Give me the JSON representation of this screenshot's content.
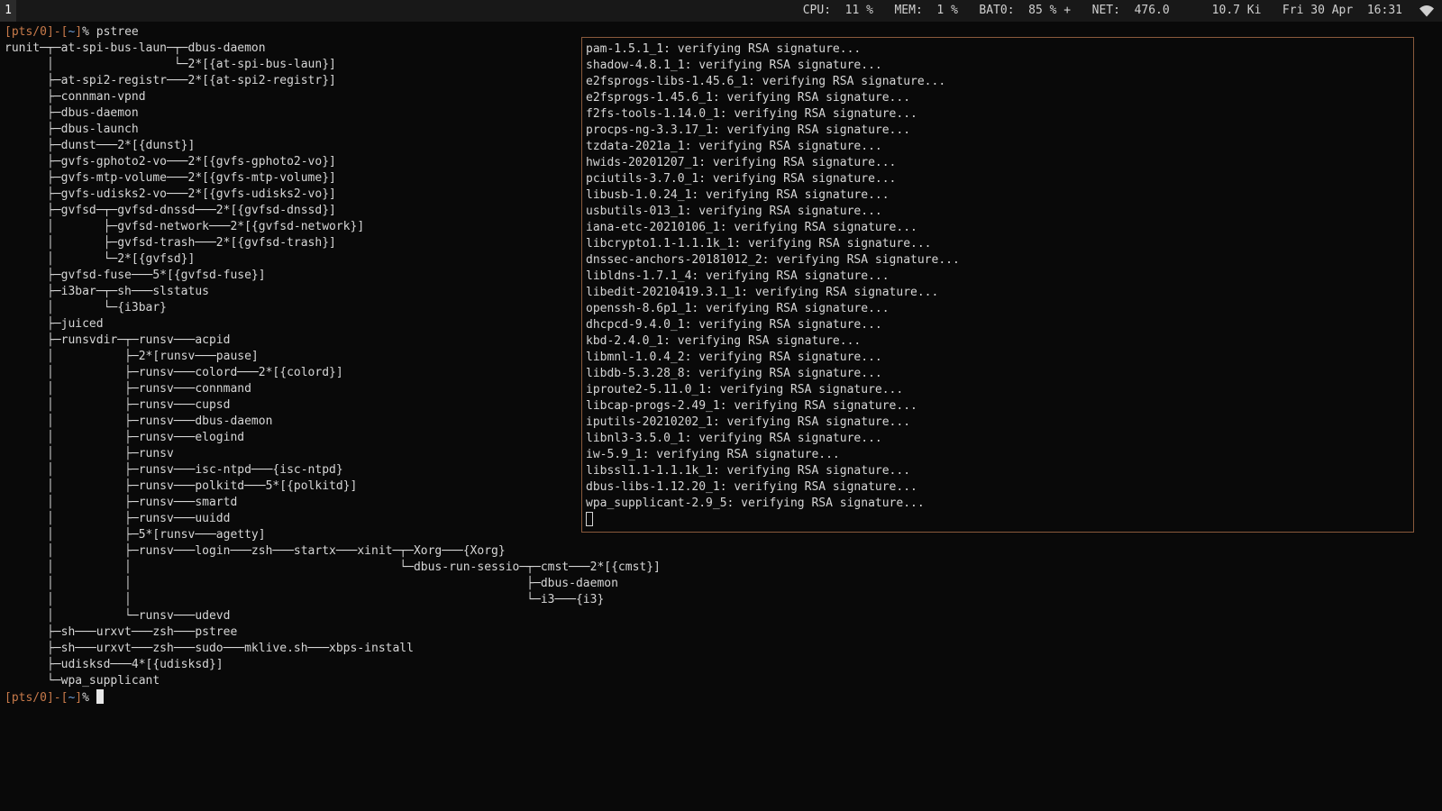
{
  "topbar": {
    "workspace": "1",
    "status": "CPU:  11 %   MEM:  1 %   BAT0:  85 % +   NET:  476.0      10.7 Ki   Fri 30 Apr  16:31",
    "wifi_icon": "wifi-icon"
  },
  "pstree_terminal": {
    "prompt": {
      "open": "[",
      "tty": "pts/0",
      "close": "]",
      "dash": "-",
      "path_open": "[",
      "path": "~",
      "path_close": "]",
      "symbol": "% "
    },
    "command": "pstree",
    "tree_lines": [
      "runit─┬─at-spi-bus-laun─┬─dbus-daemon",
      "      │                 └─2*[{at-spi-bus-laun}]",
      "      ├─at-spi2-registr───2*[{at-spi2-registr}]",
      "      ├─connman-vpnd",
      "      ├─dbus-daemon",
      "      ├─dbus-launch",
      "      ├─dunst───2*[{dunst}]",
      "      ├─gvfs-gphoto2-vo───2*[{gvfs-gphoto2-vo}]",
      "      ├─gvfs-mtp-volume───2*[{gvfs-mtp-volume}]",
      "      ├─gvfs-udisks2-vo───2*[{gvfs-udisks2-vo}]",
      "      ├─gvfsd─┬─gvfsd-dnssd───2*[{gvfsd-dnssd}]",
      "      │       ├─gvfsd-network───2*[{gvfsd-network}]",
      "      │       ├─gvfsd-trash───2*[{gvfsd-trash}]",
      "      │       └─2*[{gvfsd}]",
      "      ├─gvfsd-fuse───5*[{gvfsd-fuse}]",
      "      ├─i3bar─┬─sh───slstatus",
      "      │       └─{i3bar}",
      "      ├─juiced",
      "      ├─runsvdir─┬─runsv───acpid",
      "      │          ├─2*[runsv───pause]",
      "      │          ├─runsv───colord───2*[{colord}]",
      "      │          ├─runsv───connmand",
      "      │          ├─runsv───cupsd",
      "      │          ├─runsv───dbus-daemon",
      "      │          ├─runsv───elogind",
      "      │          ├─runsv",
      "      │          ├─runsv───isc-ntpd───{isc-ntpd}",
      "      │          ├─runsv───polkitd───5*[{polkitd}]",
      "      │          ├─runsv───smartd",
      "      │          ├─runsv───uuidd",
      "      │          ├─5*[runsv───agetty]",
      "      │          ├─runsv───login───zsh───startx───xinit─┬─Xorg───{Xorg}",
      "      │          │                                      └─dbus-run-sessio─┬─cmst───2*[{cmst}]",
      "      │          │                                                        ├─dbus-daemon",
      "      │          │                                                        └─i3───{i3}",
      "      │          └─runsv───udevd",
      "      ├─sh───urxvt───zsh───pstree",
      "      ├─sh───urxvt───zsh───sudo───mklive.sh───xbps-install",
      "      ├─udisksd───4*[{udisksd}]",
      "      └─wpa_supplicant"
    ]
  },
  "xbps_terminal": {
    "lines": [
      "pam-1.5.1_1: verifying RSA signature...",
      "shadow-4.8.1_1: verifying RSA signature...",
      "e2fsprogs-libs-1.45.6_1: verifying RSA signature...",
      "e2fsprogs-1.45.6_1: verifying RSA signature...",
      "f2fs-tools-1.14.0_1: verifying RSA signature...",
      "procps-ng-3.3.17_1: verifying RSA signature...",
      "tzdata-2021a_1: verifying RSA signature...",
      "hwids-20201207_1: verifying RSA signature...",
      "pciutils-3.7.0_1: verifying RSA signature...",
      "libusb-1.0.24_1: verifying RSA signature...",
      "usbutils-013_1: verifying RSA signature...",
      "iana-etc-20210106_1: verifying RSA signature...",
      "libcrypto1.1-1.1.1k_1: verifying RSA signature...",
      "dnssec-anchors-20181012_2: verifying RSA signature...",
      "libldns-1.7.1_4: verifying RSA signature...",
      "libedit-20210419.3.1_1: verifying RSA signature...",
      "openssh-8.6p1_1: verifying RSA signature...",
      "dhcpcd-9.4.0_1: verifying RSA signature...",
      "kbd-2.4.0_1: verifying RSA signature...",
      "libmnl-1.0.4_2: verifying RSA signature...",
      "libdb-5.3.28_8: verifying RSA signature...",
      "iproute2-5.11.0_1: verifying RSA signature...",
      "libcap-progs-2.49_1: verifying RSA signature...",
      "iputils-20210202_1: verifying RSA signature...",
      "libnl3-3.5.0_1: verifying RSA signature...",
      "iw-5.9_1: verifying RSA signature...",
      "libssl1.1-1.1.1k_1: verifying RSA signature...",
      "dbus-libs-1.12.20_1: verifying RSA signature...",
      "wpa_supplicant-2.9_5: verifying RSA signature..."
    ]
  },
  "colors": {
    "prompt_accent": "#c87a4a",
    "prompt_path": "#6f9fd8",
    "border_accent": "#8a5a3c"
  }
}
